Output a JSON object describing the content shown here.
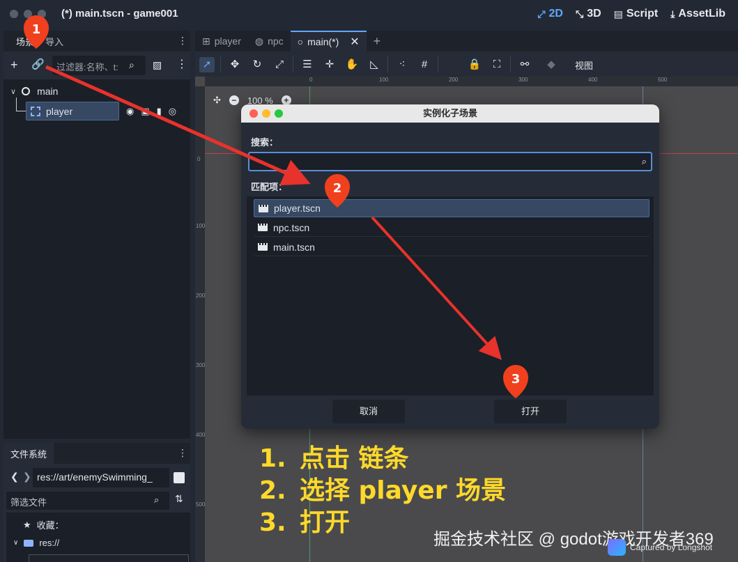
{
  "window": {
    "title": "(*) main.tscn - game001"
  },
  "modes": [
    {
      "icon": "2d-icon",
      "glyph": "⤢",
      "label": "2D"
    },
    {
      "icon": "3d-icon",
      "glyph": "⤡",
      "label": "3D"
    },
    {
      "icon": "script-icon",
      "glyph": "▤",
      "label": "Script"
    },
    {
      "icon": "assetlib-icon",
      "glyph": "⤓",
      "label": "AssetLib"
    }
  ],
  "scene_dock": {
    "tabs": [
      "场景",
      "导入"
    ],
    "filter_placeholder": "过滤器:名称、t:",
    "root_node": "main",
    "child_node": "player"
  },
  "filesystem": {
    "tab": "文件系统",
    "path": "res://art/enemySwimming_",
    "filter_placeholder": "筛选文件",
    "favorites": "收藏：",
    "root": "res://"
  },
  "editor_tabs": [
    {
      "label": "player"
    },
    {
      "label": "npc"
    },
    {
      "label": "main(*)"
    }
  ],
  "toolbar": {
    "view_label": "视图"
  },
  "viewport": {
    "zoom": "100 %",
    "ruler_h": [
      "0",
      "100",
      "200",
      "300",
      "400",
      "500"
    ],
    "ruler_v": [
      "0",
      "100",
      "200",
      "300",
      "400",
      "500"
    ]
  },
  "dialog": {
    "title": "实例化子场景",
    "search_label": "搜索：",
    "search_value": "",
    "matches_label": "匹配项：",
    "matches": [
      "player.tscn",
      "npc.tscn",
      "main.tscn"
    ],
    "cancel": "取消",
    "open": "打开"
  },
  "annotations": {
    "markers": [
      "1",
      "2",
      "3"
    ],
    "steps": [
      {
        "num": "1.",
        "text": "点击 链条"
      },
      {
        "num": "2.",
        "text": "选择 player 场景"
      },
      {
        "num": "3.",
        "text": "打开"
      }
    ],
    "marker_color": "#f0401e",
    "arrow_color": "#e8322c",
    "step_color": "#ffd92a"
  },
  "watermark": "掘金技术社区 @ godot游戏开发者369",
  "captured": "Captured by Longshot",
  "colors": {
    "accent": "#62a8ff",
    "selection": "#364862",
    "panel": "#262c37",
    "field": "#1b1f27"
  }
}
